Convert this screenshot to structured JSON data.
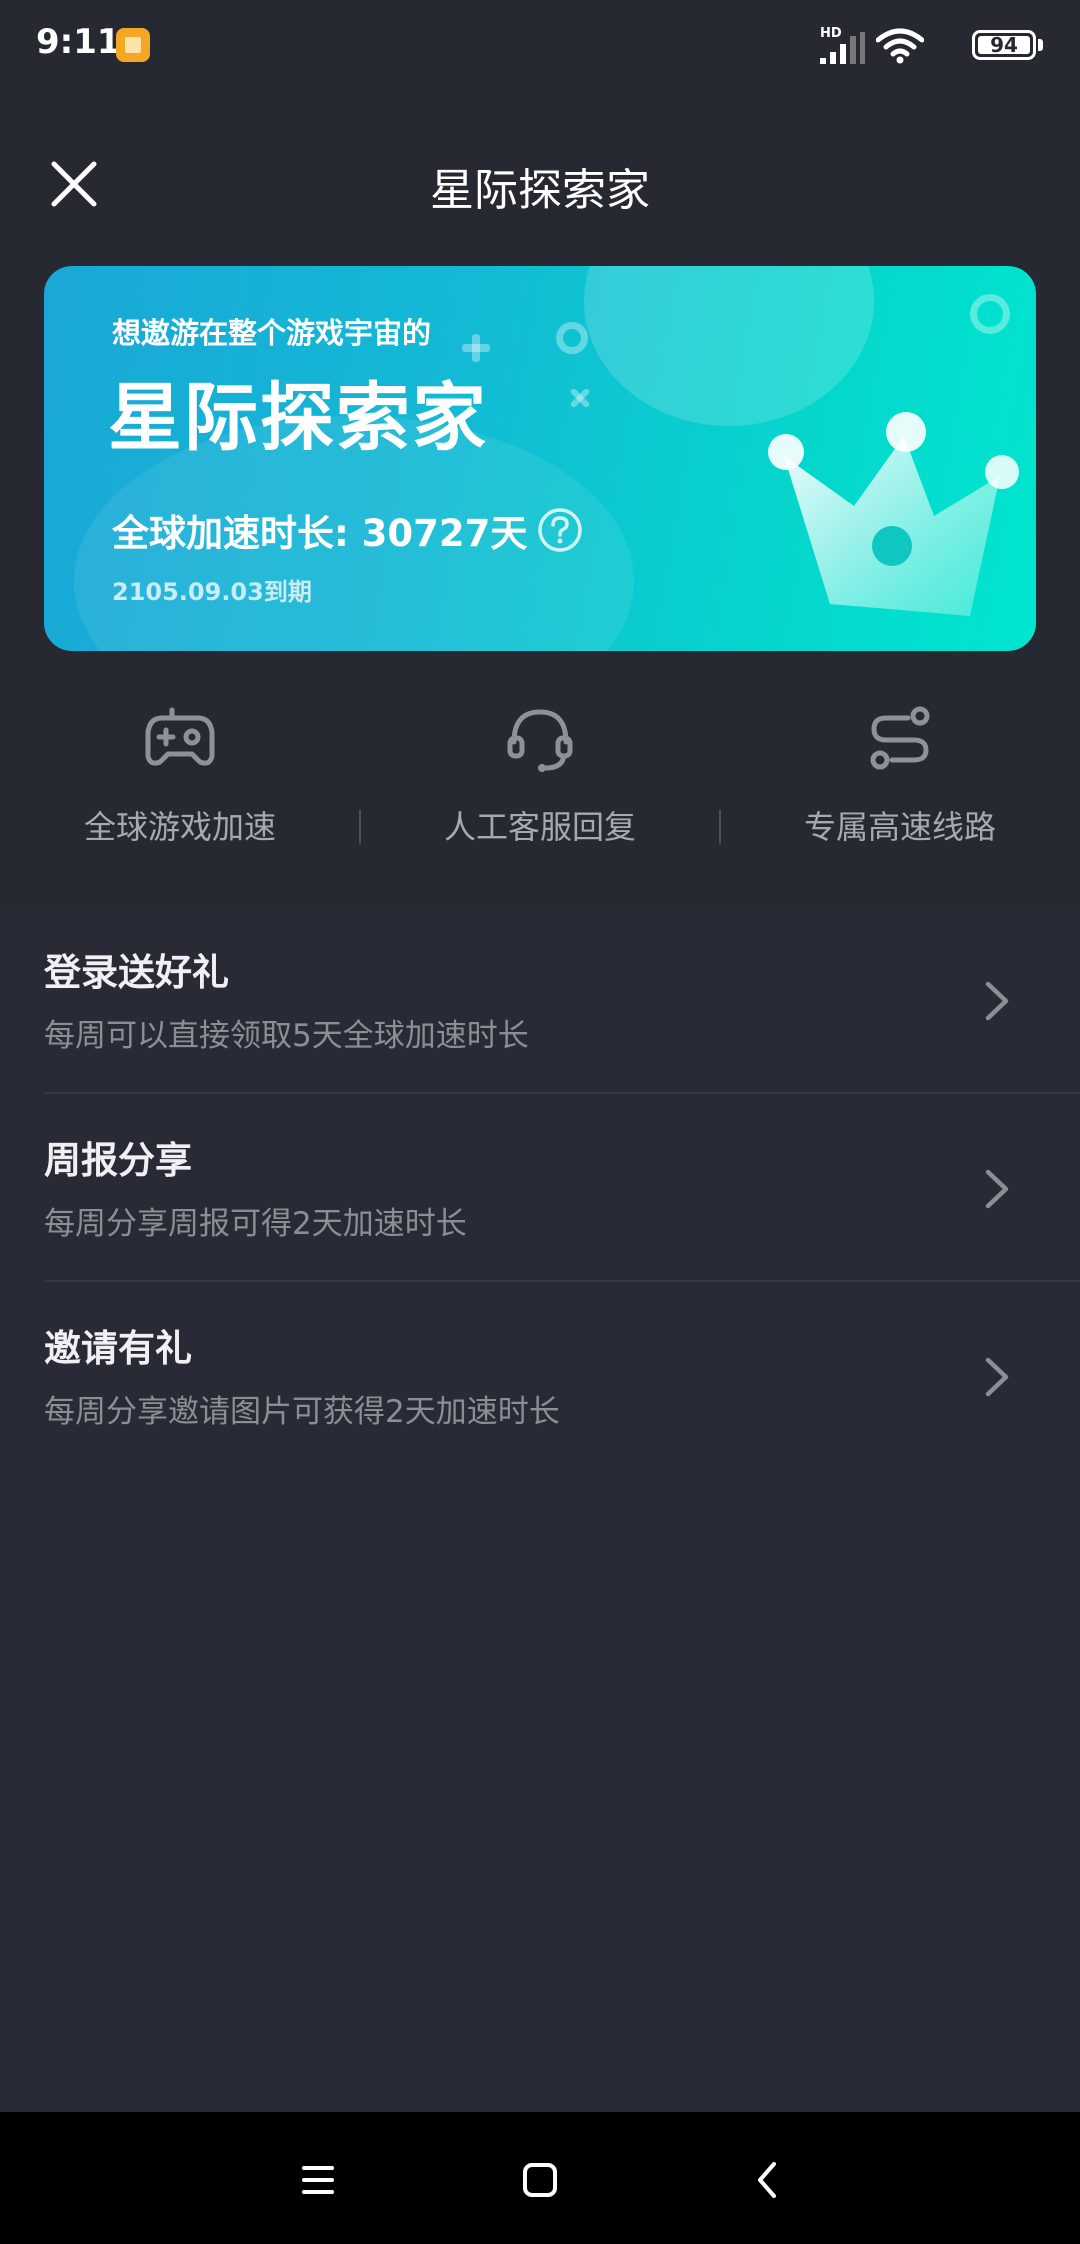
{
  "status_bar": {
    "time": "9:11",
    "network_label": "HD",
    "battery_level": "94"
  },
  "header": {
    "title": "星际探索家"
  },
  "banner": {
    "subtitle": "想遨游在整个游戏宇宙的",
    "title": "星际探索家",
    "duration_label": "全球加速时长: 30727天",
    "expiry": "2105.09.03到期",
    "gradient_start": "#1aa7d6",
    "gradient_end": "#00e6cf"
  },
  "features": [
    {
      "label": "全球游戏加速",
      "icon": "gamepad-icon"
    },
    {
      "label": "人工客服回复",
      "icon": "headset-icon"
    },
    {
      "label": "专属高速线路",
      "icon": "route-icon"
    }
  ],
  "list": [
    {
      "title": "登录送好礼",
      "description": "每周可以直接领取5天全球加速时长"
    },
    {
      "title": "周报分享",
      "description": "每周分享周报可得2天加速时长"
    },
    {
      "title": "邀请有礼",
      "description": "每周分享邀请图片可获得2天加速时长"
    }
  ],
  "colors": {
    "background": "#262932",
    "list_background": "#282b35",
    "accent": "#00e6cf"
  }
}
